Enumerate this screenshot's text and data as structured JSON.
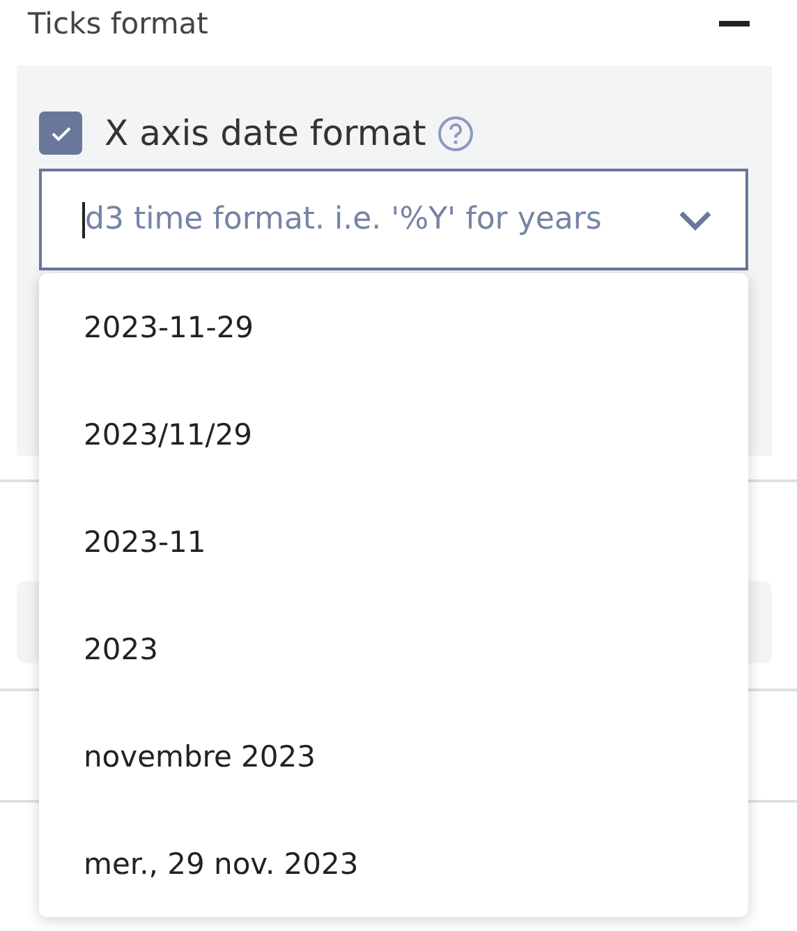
{
  "section": {
    "title": "Ticks format",
    "expanded": true
  },
  "date_format": {
    "checked": true,
    "label": "X axis date format",
    "placeholder": "d3 time format. i.e. '%Y' for years"
  },
  "options": [
    "2023-11-29",
    "2023/11/29",
    "2023-11",
    "2023",
    "novembre 2023",
    "mer., 29 nov. 2023"
  ],
  "next_sections": [
    {
      "kind": "field"
    },
    {
      "kind": "plain"
    },
    {
      "kind": "plain"
    }
  ]
}
